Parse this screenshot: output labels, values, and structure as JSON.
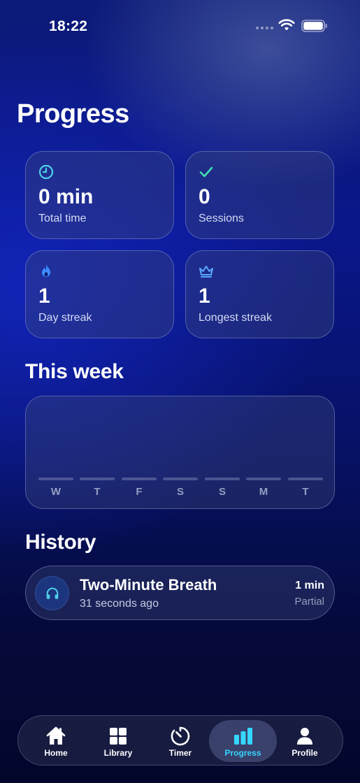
{
  "status_bar": {
    "time": "18:22"
  },
  "page": {
    "title": "Progress"
  },
  "stats": [
    {
      "value": "0 min",
      "label": "Total time",
      "icon": "clock-icon",
      "icon_color": "#4fd0e6"
    },
    {
      "value": "0",
      "label": "Sessions",
      "icon": "checkmark-icon",
      "icon_color": "#3ee0b0"
    },
    {
      "value": "1",
      "label": "Day streak",
      "icon": "flame-icon",
      "icon_color": "#3d8bff"
    },
    {
      "value": "1",
      "label": "Longest streak",
      "icon": "crown-icon",
      "icon_color": "#5aa8ff"
    }
  ],
  "this_week": {
    "title": "This week",
    "days": [
      "W",
      "T",
      "F",
      "S",
      "S",
      "M",
      "T"
    ]
  },
  "history": {
    "title": "History",
    "items": [
      {
        "title": "Two-Minute Breath",
        "time_ago": "31 seconds ago",
        "duration": "1 min",
        "status": "Partial",
        "icon": "headphones-icon"
      }
    ]
  },
  "tab_bar": {
    "active_tab": "Progress",
    "active_color": "#35d6ff",
    "tabs": [
      {
        "label": "Home",
        "icon": "home-icon"
      },
      {
        "label": "Library",
        "icon": "grid-icon"
      },
      {
        "label": "Timer",
        "icon": "timer-icon"
      },
      {
        "label": "Progress",
        "icon": "bar-chart-icon"
      },
      {
        "label": "Profile",
        "icon": "person-icon"
      }
    ]
  }
}
